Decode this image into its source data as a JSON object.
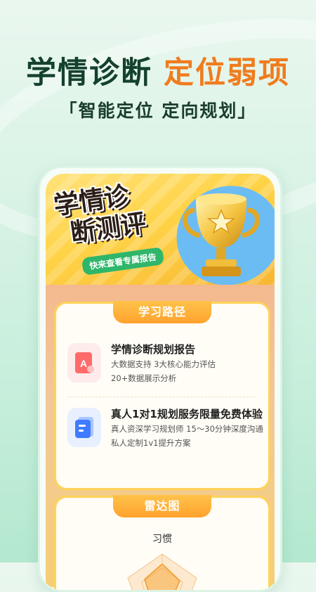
{
  "hero": {
    "title_part1": "学情诊断",
    "title_part2": "定位弱项",
    "subtitle": "「智能定位 定向规划」"
  },
  "banner": {
    "title_line1": "学情诊",
    "title_line2": "断测评",
    "badge": "快来查看专属报告"
  },
  "learning_path": {
    "tab": "学习路径",
    "items": [
      {
        "title": "学情诊断规划报告",
        "line1": "大数据支持   3大核心能力评估",
        "line2": "20+数据展示分析"
      },
      {
        "title": "真人1对1规划服务限量免费体验",
        "line1": "真人资深学习规划师   15～30分钟深度沟通",
        "line2": "私人定制1v1提升方案"
      }
    ]
  },
  "radar": {
    "tab": "雷达图",
    "label_top": "习惯"
  },
  "colors": {
    "accent_green": "#14412e",
    "accent_orange": "#f07c1e",
    "tab_orange": "#ffa22e",
    "badge_green": "#2fb66b"
  }
}
